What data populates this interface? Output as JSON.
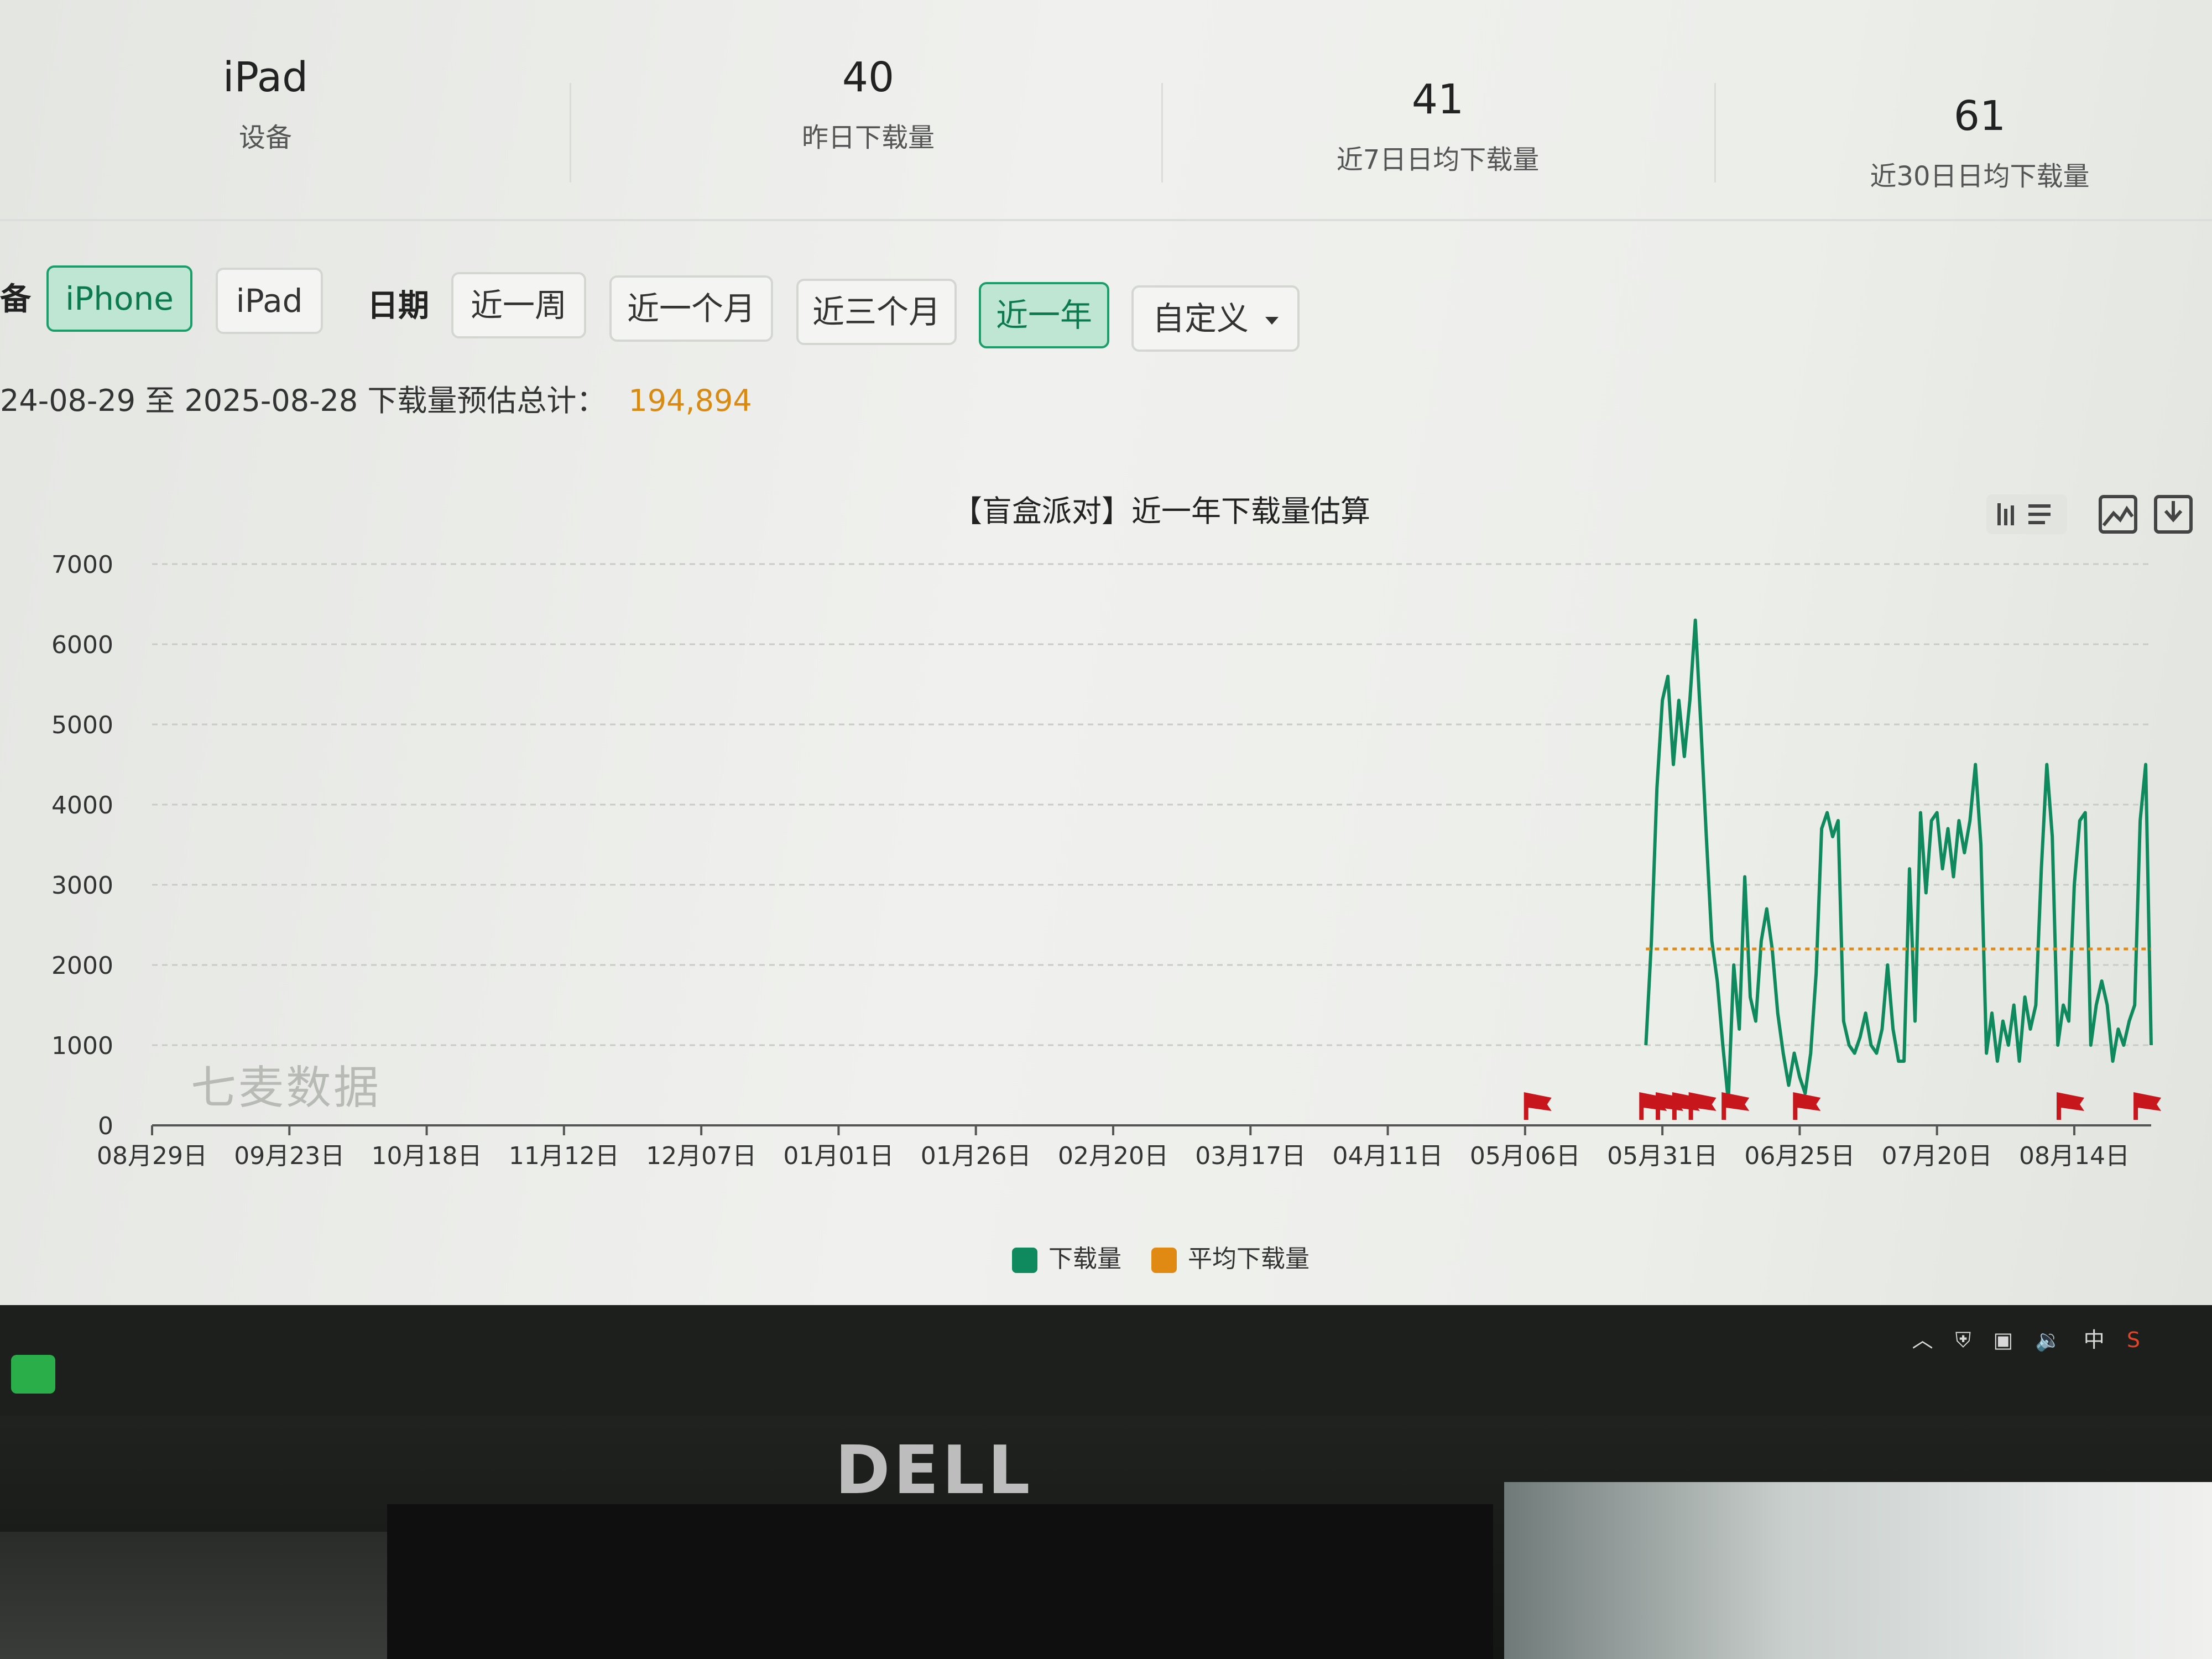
{
  "stats": [
    {
      "value": "iPad",
      "label": "设备"
    },
    {
      "value": "40",
      "label": "昨日下载量"
    },
    {
      "value": "41",
      "label": "近7日日均下载量"
    },
    {
      "value": "61",
      "label": "近30日日均下载量"
    }
  ],
  "filters": {
    "device_label": "备",
    "device_options": [
      "iPhone",
      "iPad"
    ],
    "device_selected": "iPhone",
    "date_label": "日期",
    "date_options": [
      "近一周",
      "近一个月",
      "近三个月",
      "近一年"
    ],
    "date_selected": "近一年",
    "custom_label": "自定义"
  },
  "summary": {
    "range_text": "24-08-29 至 2025-08-28 下载量预估总计：",
    "total": "194,894"
  },
  "watermark": "七麦数据",
  "colors": {
    "series_download": "#0f8a5f",
    "series_average": "#e08a14",
    "marker": "#c8161d",
    "active_button": "#bfe6d3"
  },
  "chart_data": {
    "type": "line",
    "title": "【盲盒派对】近一年下载量估算",
    "ylim": [
      0,
      7000
    ],
    "y_ticks": [
      "0",
      "1000",
      "2000",
      "3000",
      "4000",
      "5000",
      "6000",
      "7000"
    ],
    "x_ticks": [
      "08月29日",
      "09月23日",
      "10月18日",
      "11月12日",
      "12月07日",
      "01月01日",
      "01月26日",
      "02月20日",
      "03月17日",
      "04月11日",
      "05月06日",
      "05月31日",
      "06月25日",
      "07月20日",
      "08月14日"
    ],
    "x_tick_days": [
      0,
      25,
      50,
      75,
      100,
      125,
      150,
      175,
      200,
      225,
      250,
      275,
      300,
      325,
      350
    ],
    "x_max_day": 364,
    "legend": [
      "下载量",
      "平均下载量"
    ],
    "series": [
      {
        "name": "下载量",
        "points": [
          [
            272,
            1000
          ],
          [
            273,
            2300
          ],
          [
            274,
            4200
          ],
          [
            275,
            5300
          ],
          [
            276,
            5600
          ],
          [
            277,
            4500
          ],
          [
            278,
            5300
          ],
          [
            279,
            4600
          ],
          [
            280,
            5300
          ],
          [
            281,
            6300
          ],
          [
            282,
            5000
          ],
          [
            283,
            3600
          ],
          [
            284,
            2300
          ],
          [
            285,
            1800
          ],
          [
            286,
            1000
          ],
          [
            287,
            300
          ],
          [
            288,
            2000
          ],
          [
            289,
            1200
          ],
          [
            290,
            3100
          ],
          [
            291,
            1600
          ],
          [
            292,
            1300
          ],
          [
            293,
            2300
          ],
          [
            294,
            2700
          ],
          [
            295,
            2200
          ],
          [
            296,
            1400
          ],
          [
            297,
            900
          ],
          [
            298,
            500
          ],
          [
            299,
            900
          ],
          [
            300,
            600
          ],
          [
            301,
            400
          ],
          [
            302,
            900
          ],
          [
            303,
            1900
          ],
          [
            304,
            3700
          ],
          [
            305,
            3900
          ],
          [
            306,
            3600
          ],
          [
            307,
            3800
          ],
          [
            308,
            1300
          ],
          [
            309,
            1000
          ],
          [
            310,
            900
          ],
          [
            311,
            1100
          ],
          [
            312,
            1400
          ],
          [
            313,
            1000
          ],
          [
            314,
            900
          ],
          [
            315,
            1200
          ],
          [
            316,
            2000
          ],
          [
            317,
            1200
          ],
          [
            318,
            800
          ],
          [
            319,
            800
          ],
          [
            320,
            3200
          ],
          [
            321,
            1300
          ],
          [
            322,
            3900
          ],
          [
            323,
            2900
          ],
          [
            324,
            3800
          ],
          [
            325,
            3900
          ],
          [
            326,
            3200
          ],
          [
            327,
            3700
          ],
          [
            328,
            3100
          ],
          [
            329,
            3800
          ],
          [
            330,
            3400
          ],
          [
            331,
            3800
          ],
          [
            332,
            4500
          ],
          [
            333,
            3500
          ],
          [
            334,
            900
          ],
          [
            335,
            1400
          ],
          [
            336,
            800
          ],
          [
            337,
            1300
          ],
          [
            338,
            1000
          ],
          [
            339,
            1500
          ],
          [
            340,
            800
          ],
          [
            341,
            1600
          ],
          [
            342,
            1200
          ],
          [
            343,
            1500
          ],
          [
            344,
            3200
          ],
          [
            345,
            4500
          ],
          [
            346,
            3600
          ],
          [
            347,
            1000
          ],
          [
            348,
            1500
          ],
          [
            349,
            1300
          ],
          [
            350,
            3000
          ],
          [
            351,
            3800
          ],
          [
            352,
            3900
          ],
          [
            353,
            1000
          ],
          [
            354,
            1500
          ],
          [
            355,
            1800
          ],
          [
            356,
            1500
          ],
          [
            357,
            800
          ],
          [
            358,
            1200
          ],
          [
            359,
            1000
          ],
          [
            360,
            1300
          ],
          [
            361,
            1500
          ],
          [
            362,
            3800
          ],
          [
            363,
            4500
          ],
          [
            364,
            1000
          ]
        ]
      },
      {
        "name": "平均下载量",
        "points": [
          [
            272,
            2200
          ],
          [
            364,
            2200
          ]
        ]
      }
    ],
    "markers_days": [
      252,
      273,
      276,
      279,
      282,
      288,
      301,
      349,
      363
    ]
  }
}
